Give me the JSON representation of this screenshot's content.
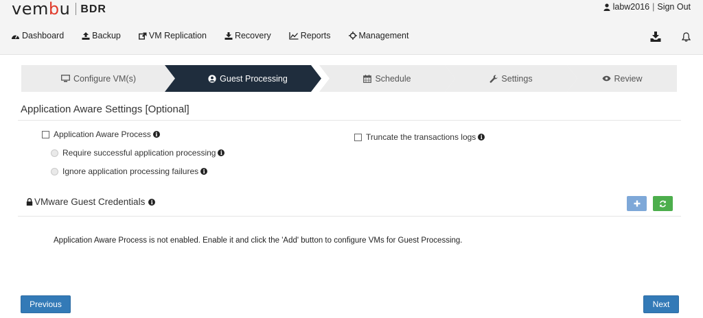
{
  "header": {
    "logo_text_main": "vem",
    "logo_text_u": "b",
    "logo_text_end": "u",
    "logo_product": "BDR",
    "user_name": "labw2016",
    "separator": "|",
    "sign_out": "Sign Out"
  },
  "nav": {
    "items": [
      {
        "label": "Dashboard",
        "icon": "dashboard-icon"
      },
      {
        "label": "Backup",
        "icon": "upload-icon"
      },
      {
        "label": "VM Replication",
        "icon": "external-link-icon"
      },
      {
        "label": "Recovery",
        "icon": "download-icon"
      },
      {
        "label": "Reports",
        "icon": "line-chart-icon"
      },
      {
        "label": "Management",
        "icon": "crosshairs-icon"
      }
    ],
    "tools": [
      "download-tray-icon",
      "bell-icon"
    ]
  },
  "wizard": {
    "steps": [
      {
        "label": "Configure VM(s)",
        "icon": "monitor-icon",
        "active": false
      },
      {
        "label": "Guest Processing",
        "icon": "user-circle-icon",
        "active": true
      },
      {
        "label": "Schedule",
        "icon": "calendar-icon",
        "active": false
      },
      {
        "label": "Settings",
        "icon": "wrench-icon",
        "active": false
      },
      {
        "label": "Review",
        "icon": "eye-icon",
        "active": false
      }
    ]
  },
  "app_aware": {
    "title": "Application Aware Settings [Optional]",
    "process_label": "Application Aware Process",
    "require_label": "Require successful application processing",
    "ignore_label": "Ignore application processing failures",
    "truncate_label": "Truncate the transactions logs"
  },
  "credentials": {
    "title": "VMware Guest Credentials",
    "message": "Application Aware Process is not enabled. Enable it and click the 'Add' button to configure VMs for Guest Processing."
  },
  "footer": {
    "previous": "Previous",
    "next": "Next"
  },
  "colors": {
    "active_step": "#1f2d3d",
    "inactive_step": "#ececec",
    "primary_button": "#337ab7",
    "add_button": "#7ea8d8",
    "refresh_button": "#4cae4c",
    "logo_accent": "#e03b2b"
  }
}
